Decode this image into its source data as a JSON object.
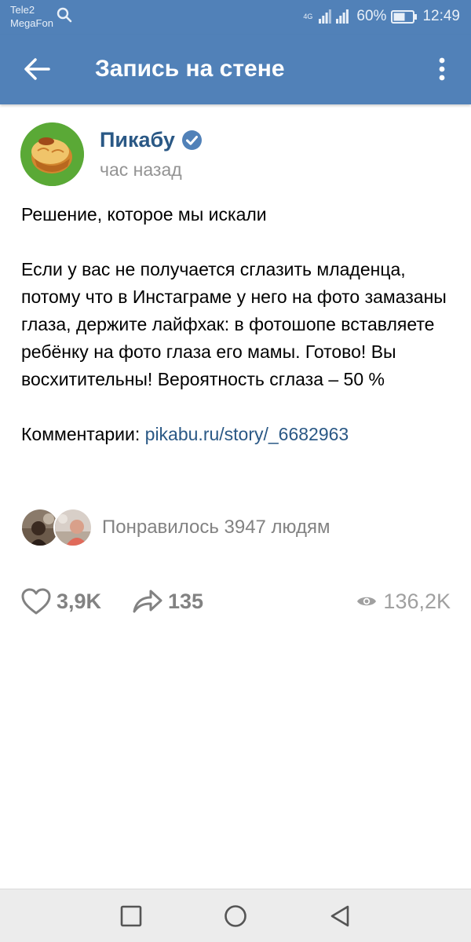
{
  "status_bar": {
    "carrier_1": "Tele2",
    "carrier_2": "MegaFon",
    "network": "4G",
    "battery": "60%",
    "time": "12:49"
  },
  "app_bar": {
    "title": "Запись на стене"
  },
  "post": {
    "author": "Пикабу",
    "time": "час назад",
    "headline": "Решение, которое мы искали",
    "body": "Если у вас не получается сглазить младенца, потому что в Инстаграме у него на фото замазаны глаза, держите лайфхак: в фотошопе вставляете ребёнку на фото глаза его мамы. Готово! Вы восхитительны! Вероятность сглаза – 50 %",
    "comments_label": "Комментарии: ",
    "comments_link": "pikabu.ru/story/_6682963"
  },
  "likes": {
    "text": "Понравилось 3947 людям"
  },
  "actions": {
    "likes_count": "3,9K",
    "shares_count": "135",
    "views_count": "136,2K"
  },
  "colors": {
    "header_blue": "#5181b8",
    "link_blue": "#2a5885",
    "avatar_green": "#5aa936"
  },
  "icons": [
    "back-arrow-icon",
    "more-vertical-icon",
    "verified-icon",
    "heart-icon",
    "share-icon",
    "eye-icon",
    "recent-apps-icon",
    "home-icon",
    "back-triangle-icon",
    "search-icon"
  ]
}
